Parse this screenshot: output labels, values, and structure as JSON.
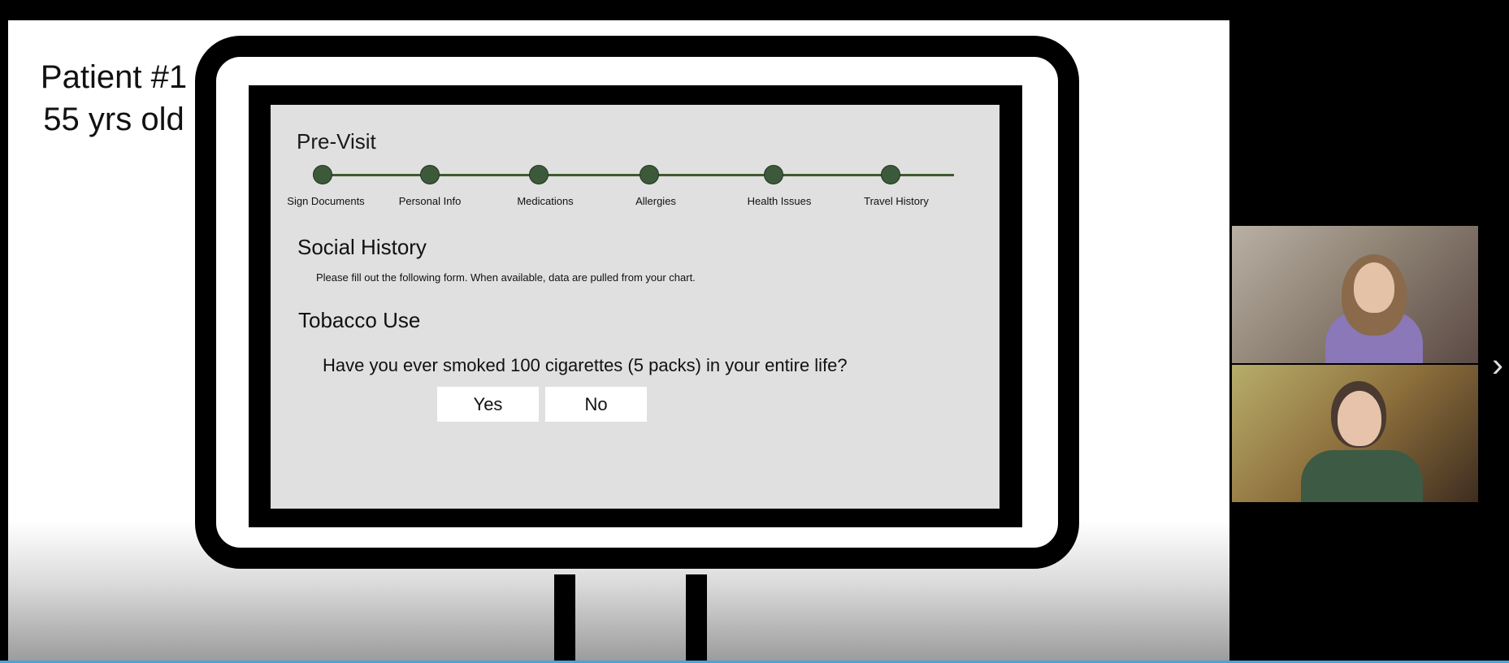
{
  "slide": {
    "patient_line1": "Patient #1",
    "patient_line2": "55 yrs old"
  },
  "kiosk": {
    "progress_title": "Pre-Visit",
    "steps": [
      "Sign Documents",
      "Personal Info",
      "Medications",
      "Allergies",
      "Health Issues",
      "Travel History"
    ],
    "section_title": "Social History",
    "section_desc": "Please fill out the following form. When available, data are pulled from your chart.",
    "subsection_title": "Tobacco Use",
    "question": "Have you ever smoked 100 cigarettes (5 packs) in your entire life?",
    "yes_label": "Yes",
    "no_label": "No"
  },
  "participants": [
    {
      "tile": "participant-video-1"
    },
    {
      "tile": "participant-video-2"
    }
  ],
  "controls": {
    "next_icon": "chevron-right-icon",
    "next_glyph": "›"
  },
  "colors": {
    "step_dot": "#3c5a3a",
    "track": "#3f5a2e",
    "screen_bg": "#e0e0e0"
  }
}
